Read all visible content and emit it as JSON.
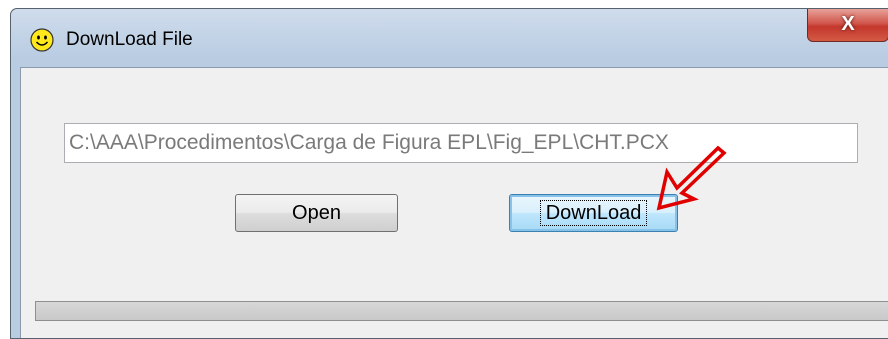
{
  "window": {
    "title": "DownLoad File",
    "close_symbol": "X",
    "app_icon": "smiley-icon"
  },
  "file_path": {
    "value": "C:\\AAA\\Procedimentos\\Carga de Figura EPL\\Fig_EPL\\CHT.PCX"
  },
  "buttons": {
    "open_label": "Open",
    "download_label": "DownLoad"
  },
  "annotation": {
    "arrow_color": "#e00000",
    "target": "download-button"
  },
  "progress": {
    "value": 0
  }
}
